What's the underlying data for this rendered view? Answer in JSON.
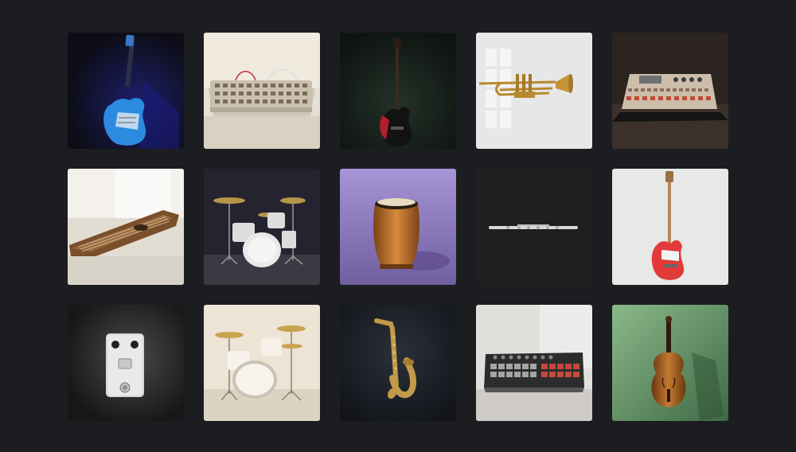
{
  "gallery": {
    "tiles": [
      {
        "subject": "electric-guitar-blue",
        "bg": "#16172a"
      },
      {
        "subject": "drum-machine-beige",
        "bg": "#e5ddd0"
      },
      {
        "subject": "bass-guitar-red",
        "bg": "#1a211d"
      },
      {
        "subject": "trumpet",
        "bg": "#e3e4e4"
      },
      {
        "subject": "synthesizer-workstation",
        "bg": "#2e2823"
      },
      {
        "subject": "zither",
        "bg": "#e9e6e0"
      },
      {
        "subject": "drum-kit-dark",
        "bg": "#242232"
      },
      {
        "subject": "conga-drum",
        "bg": "#8b79b6"
      },
      {
        "subject": "flute",
        "bg": "#1e1e1e"
      },
      {
        "subject": "bass-guitar-red-on-white",
        "bg": "#e6e9e6"
      },
      {
        "subject": "effects-pedal",
        "bg": "#2a2a2a"
      },
      {
        "subject": "drum-kit-light",
        "bg": "#ebe2d4"
      },
      {
        "subject": "saxophone",
        "bg": "#1c1f24"
      },
      {
        "subject": "drum-pad-controller",
        "bg": "#dcdad6"
      },
      {
        "subject": "violin",
        "bg": "#5b8a5f"
      }
    ]
  }
}
